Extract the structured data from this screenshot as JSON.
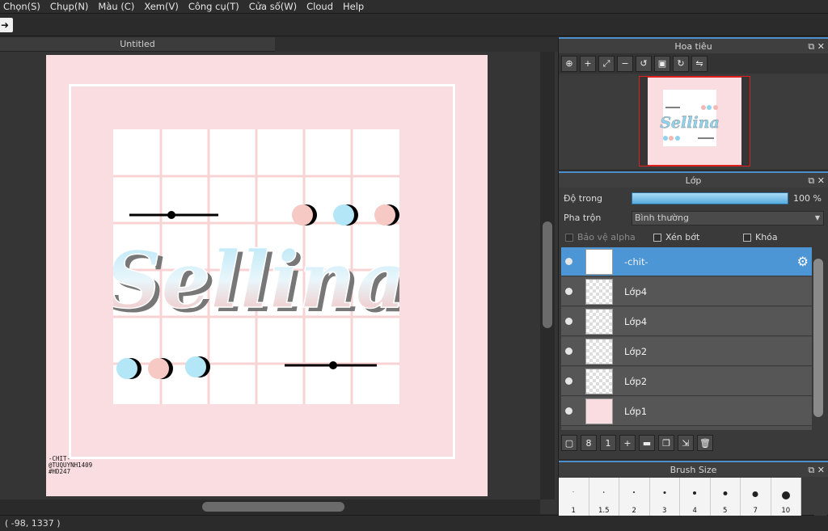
{
  "menu": [
    "Chọn(S)",
    "Chụp(N)",
    "Màu (C)",
    "Xem(V)",
    "Công cụ(T)",
    "Cửa số(W)",
    "Cloud",
    "Help"
  ],
  "toolbar": {
    "icon": "arrow-right-icon"
  },
  "document": {
    "tab_title": "Untitled",
    "artwork_title": "Sellina",
    "watermark": [
      "-CHIT-",
      "@TUQUYNH1409",
      "#HD247"
    ]
  },
  "status": {
    "coords": "( -98, 1337 )"
  },
  "navigator": {
    "title": "Hoa tiêu"
  },
  "layers_panel": {
    "title": "Lớp",
    "opacity_label": "Độ trong",
    "opacity_value": "100 %",
    "opacity_fraction": 1.0,
    "blend_label": "Pha trộn",
    "blend_value": "Bình thường",
    "protect_alpha": "Bảo vệ alpha",
    "clipping": "Xén bớt",
    "lock": "Khóa",
    "layers": [
      {
        "name": "-chit-",
        "selected": true
      },
      {
        "name": "Lớp4",
        "selected": false
      },
      {
        "name": "Lớp4",
        "selected": false
      },
      {
        "name": "Lớp2",
        "selected": false
      },
      {
        "name": "Lớp2",
        "selected": false
      },
      {
        "name": "Lớp1",
        "selected": false
      }
    ]
  },
  "brush_panel": {
    "title": "Brush Size",
    "sizes": [
      "1",
      "1.5",
      "2",
      "3",
      "4",
      "5",
      "7",
      "10"
    ]
  },
  "colors": {
    "accent": "#4c96d6",
    "paper": "#fadde0",
    "pink": "#f6c9c4",
    "blue": "#b3e6f7"
  }
}
